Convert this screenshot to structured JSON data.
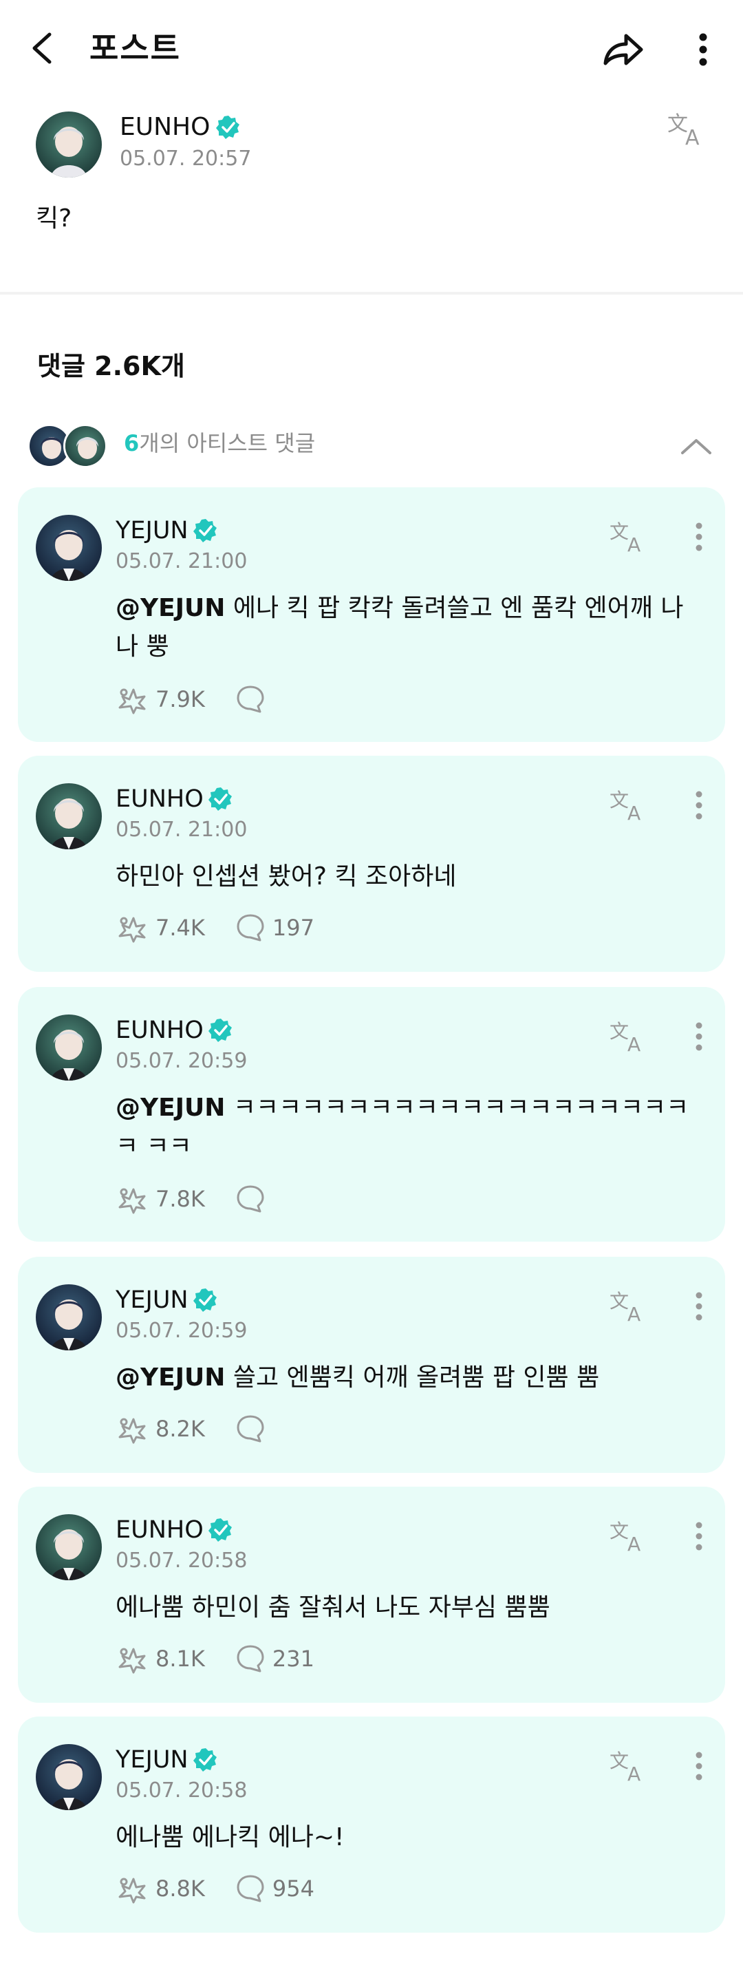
{
  "header": {
    "title": "포스트",
    "icons": [
      "back-arrow",
      "share-arrow",
      "more-vertical"
    ]
  },
  "post": {
    "author": "EUNHO",
    "time": "05.07. 20:57",
    "body": "킥?",
    "icons": [
      "verified-badge",
      "translate"
    ]
  },
  "comments_count": "댓글 2.6K개",
  "artist_comments": {
    "number": "6",
    "label": "개의 아티스트 댓글"
  },
  "colors": {
    "accent": "#22c6bd",
    "card_bg": "#e8fcf8",
    "muted": "#8c8c8c"
  },
  "comments": [
    {
      "author": "YEJUN",
      "time": "05.07. 21:00",
      "mention": "@YEJUN",
      "text": " 에나 킥 팝 칵칵 돌려쓸고 엔 품칵 엔어깨 나나 뿡",
      "likes": "7.9K",
      "replies": ""
    },
    {
      "author": "EUNHO",
      "time": "05.07. 21:00",
      "mention": "",
      "text": "하민아 인셉션 봤어? 킥 조아하네",
      "likes": "7.4K",
      "replies": "197"
    },
    {
      "author": "EUNHO",
      "time": "05.07. 20:59",
      "mention": "@YEJUN",
      "text": " ㅋㅋㅋㅋㅋㅋㅋㅋㅋㅋㅋㅋㅋㅋㅋㅋㅋㅋㅋㅋㅋ ㅋㅋ",
      "likes": "7.8K",
      "replies": ""
    },
    {
      "author": "YEJUN",
      "time": "05.07. 20:59",
      "mention": "@YEJUN",
      "text": " 쓸고 엔뿜킥 어깨 올려뿜 팝 인뿜 뿜",
      "likes": "8.2K",
      "replies": ""
    },
    {
      "author": "EUNHO",
      "time": "05.07. 20:58",
      "mention": "",
      "text": "에나뿜 하민이 춤 잘춰서 나도 자부심 뿜뿜",
      "likes": "8.1K",
      "replies": "231"
    },
    {
      "author": "YEJUN",
      "time": "05.07. 20:58",
      "mention": "",
      "text": "에나뿜 에나킥 에나~!",
      "likes": "8.8K",
      "replies": "954"
    }
  ]
}
